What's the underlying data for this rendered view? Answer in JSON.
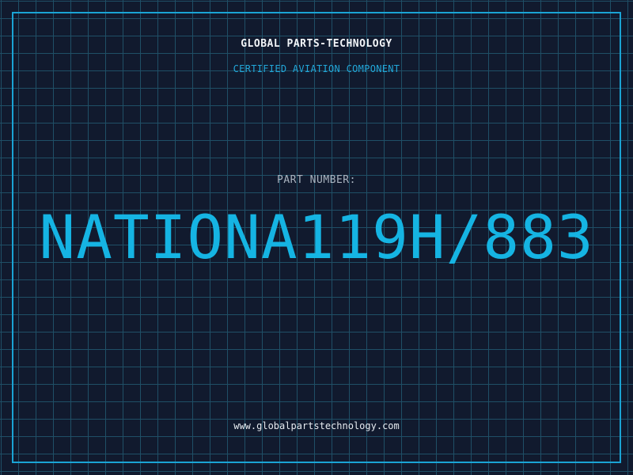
{
  "header": {
    "brand": "GLOBAL PARTS-TECHNOLOGY",
    "tagline": "CERTIFIED AVIATION COMPONENT"
  },
  "main": {
    "part_label": "PART NUMBER:",
    "part_number": "NATIONA119H/883"
  },
  "footer": {
    "website": "www.globalpartstechnology.com"
  },
  "colors": {
    "background": "#111a2e",
    "grid": "#1f4f66",
    "accent": "#15b4e3",
    "border": "#1aa3d4"
  }
}
